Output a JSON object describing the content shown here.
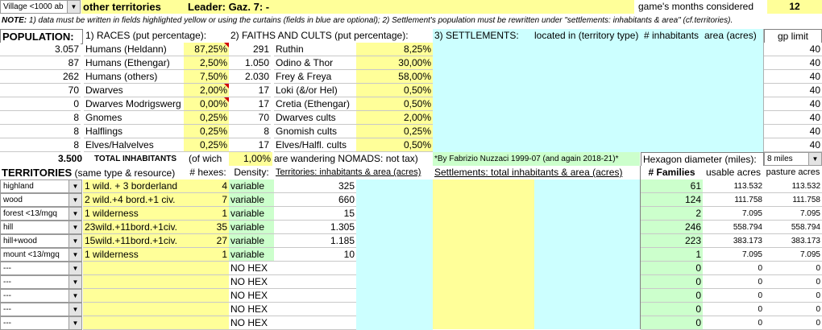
{
  "header": {
    "settlement_select": "Village <1000 ab",
    "title": "other territories",
    "leader": "Leader: Gaz. 7: -",
    "months_label": "game's months considered",
    "months_value": "12"
  },
  "note": {
    "label": "NOTE:",
    "text": "1) data must be written in fields highlighted yellow or using the curtains (fields in blue are optional); 2) Settlement's population must be rewritten under \"settlements: inhabitants & area\" (cf.territories)."
  },
  "population": {
    "title": "POPULATION:",
    "races_header": "1) RACES (put percentage):",
    "faiths_header": "2) FAITHS AND CULTS (put percentage):",
    "settlements_header": "3) SETTLEMENTS:",
    "located_header": "located in (territory type)",
    "inhabitants_header": "# inhabitants",
    "area_header": "area (acres)",
    "gp_header": "gp limit",
    "rows": [
      {
        "count": "3.057",
        "race": "Humans (Heldann)",
        "race_pct": "87,25%",
        "fcount": "291",
        "faith": "Ruthin",
        "faith_pct": "8,25%",
        "gp": "40"
      },
      {
        "count": "87",
        "race": "Humans (Ethengar)",
        "race_pct": "2,50%",
        "fcount": "1.050",
        "faith": "Odino & Thor",
        "faith_pct": "30,00%",
        "gp": "40"
      },
      {
        "count": "262",
        "race": "Humans (others)",
        "race_pct": "7,50%",
        "fcount": "2.030",
        "faith": "Frey & Freya",
        "faith_pct": "58,00%",
        "gp": "40"
      },
      {
        "count": "70",
        "race": "Dwarves",
        "race_pct": "2,00%",
        "fcount": "17",
        "faith": "Loki (&/or Hel)",
        "faith_pct": "0,50%",
        "gp": "40"
      },
      {
        "count": "0",
        "race": "Dwarves Modrigswerg",
        "race_pct": "0,00%",
        "fcount": "17",
        "faith": "Cretia (Ethengar)",
        "faith_pct": "0,50%",
        "gp": "40"
      },
      {
        "count": "8",
        "race": "Gnomes",
        "race_pct": "0,25%",
        "fcount": "70",
        "faith": "Dwarves cults",
        "faith_pct": "2,00%",
        "gp": "40"
      },
      {
        "count": "8",
        "race": "Halflings",
        "race_pct": "0,25%",
        "fcount": "8",
        "faith": "Gnomish cults",
        "faith_pct": "0,25%",
        "gp": "40"
      },
      {
        "count": "8",
        "race": "Elves/Halvelves",
        "race_pct": "0,25%",
        "fcount": "17",
        "faith": "Elves/Halfl. cults",
        "faith_pct": "0,50%",
        "gp": "40"
      }
    ],
    "total_count": "3.500",
    "total_label": "TOTAL INHABITANTS",
    "of_which": "(of wich",
    "nomads_pct": "1,00%",
    "nomads_text": "are wandering NOMADS: not tax)",
    "credit": "*By Fabrizio Nuzzaci 1999-07 (and again 2018-21)*",
    "hex_label": "Hexagon diameter (miles):",
    "hex_select": "8 miles"
  },
  "territories": {
    "title": "TERRITORIES",
    "title_note": "(same type & resource)",
    "hexes_header": "# hexes:",
    "density_header": "Density:",
    "inhab_header": "Territories: inhabitants & area (acres)",
    "settl_header": "Settlements: total inhabitants & area (acres)",
    "families_header": "# Families",
    "usable_header": "usable acres",
    "pasture_header": "pasture acres",
    "rows": [
      {
        "type": "highland",
        "desc": "1 wild. + 3 borderland",
        "hexes": "4",
        "density": "variable",
        "inhab": "325",
        "families": "61",
        "usable": "113.532",
        "pasture": "113.532"
      },
      {
        "type": "wood",
        "desc": "2 wild.+4 bord.+1 civ.",
        "hexes": "7",
        "density": "variable",
        "inhab": "660",
        "families": "124",
        "usable": "111.758",
        "pasture": "111.758"
      },
      {
        "type": "forest <13/mgq",
        "desc": "1 wilderness",
        "hexes": "1",
        "density": "variable",
        "inhab": "15",
        "families": "2",
        "usable": "7.095",
        "pasture": "7.095"
      },
      {
        "type": "hill",
        "desc": "23wild.+11bord.+1civ.",
        "hexes": "35",
        "density": "variable",
        "inhab": "1.305",
        "families": "246",
        "usable": "558.794",
        "pasture": "558.794"
      },
      {
        "type": "hill+wood",
        "desc": "15wild.+11bord.+1civ.",
        "hexes": "27",
        "density": "variable",
        "inhab": "1.185",
        "families": "223",
        "usable": "383.173",
        "pasture": "383.173"
      },
      {
        "type": "mount <13/mgq",
        "desc": "1 wilderness",
        "hexes": "1",
        "density": "variable",
        "inhab": "10",
        "families": "1",
        "usable": "7.095",
        "pasture": "7.095"
      },
      {
        "type": "---",
        "desc": "",
        "hexes": "",
        "density": "NO HEX",
        "inhab": "",
        "families": "0",
        "usable": "0",
        "pasture": "0"
      },
      {
        "type": "---",
        "desc": "",
        "hexes": "",
        "density": "NO HEX",
        "inhab": "",
        "families": "0",
        "usable": "0",
        "pasture": "0"
      },
      {
        "type": "---",
        "desc": "",
        "hexes": "",
        "density": "NO HEX",
        "inhab": "",
        "families": "0",
        "usable": "0",
        "pasture": "0"
      },
      {
        "type": "---",
        "desc": "",
        "hexes": "",
        "density": "NO HEX",
        "inhab": "",
        "families": "0",
        "usable": "0",
        "pasture": "0"
      },
      {
        "type": "---",
        "desc": "",
        "hexes": "",
        "density": "NO HEX",
        "inhab": "",
        "families": "0",
        "usable": "0",
        "pasture": "0"
      }
    ]
  },
  "icons": {
    "dropdown": "chevron-down-icon",
    "comment": "comment-marker-icon"
  },
  "colors": {
    "yellow": "#ffff99",
    "blue": "#ccffff",
    "green": "#ccffcc",
    "comment": "#d00000"
  }
}
